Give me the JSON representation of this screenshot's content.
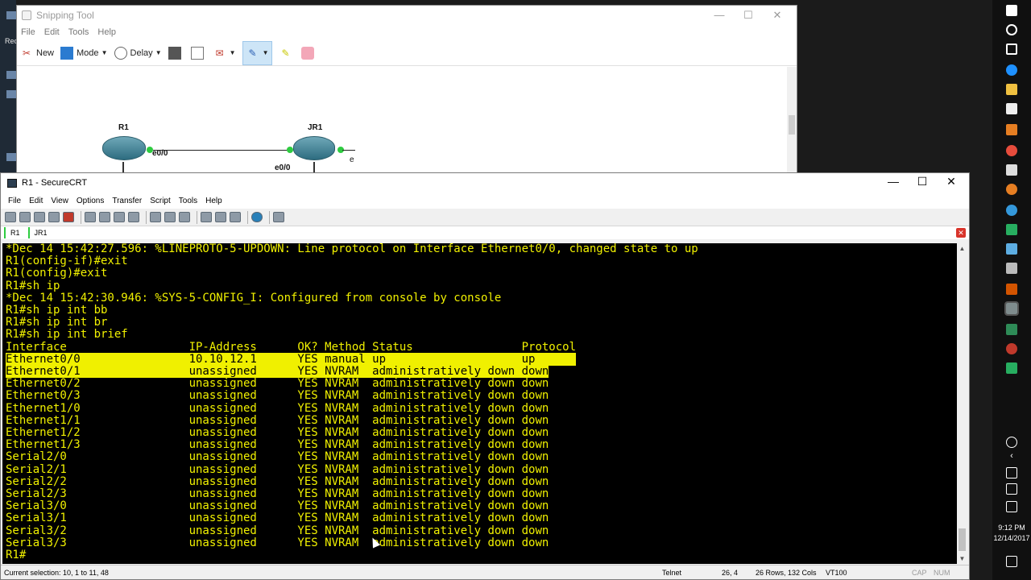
{
  "desktop": {
    "side_label": "Rec"
  },
  "snipping_tool": {
    "title": "Snipping Tool",
    "menu": [
      "File",
      "Edit",
      "Tools",
      "Help"
    ],
    "toolbar": {
      "new": "New",
      "mode": "Mode",
      "delay": "Delay"
    },
    "diagram": {
      "r1": "R1",
      "jr1": "JR1",
      "r1_port": "e0/0",
      "jr1_port": "e0/0",
      "jr1_port2": "e"
    }
  },
  "securecrt": {
    "title": "R1 - SecureCRT",
    "menu": [
      "File",
      "Edit",
      "View",
      "Options",
      "Transfer",
      "Script",
      "Tools",
      "Help"
    ],
    "tabs": [
      "R1",
      "JR1"
    ],
    "terminal_lines_top": [
      "*Dec 14 15:42:27.596: %LINEPROTO-5-UPDOWN: Line protocol on Interface Ethernet0/0, changed state to up",
      "R1(config-if)#exit",
      "R1(config)#exit",
      "R1#sh ip",
      "*Dec 14 15:42:30.946: %SYS-5-CONFIG_I: Configured from console by console",
      "R1#sh ip int bb",
      "R1#sh ip int br",
      "R1#sh ip int brief",
      "Interface                  IP-Address      OK? Method Status                Protocol"
    ],
    "highlighted_lines": [
      "Ethernet0/0                10.10.12.1      YES manual up                    up      ",
      "Ethernet0/1                unassigned      YES NVRAM  administratively down down"
    ],
    "terminal_lines_bottom": [
      "Ethernet0/2                unassigned      YES NVRAM  administratively down down",
      "Ethernet0/3                unassigned      YES NVRAM  administratively down down",
      "Ethernet1/0                unassigned      YES NVRAM  administratively down down",
      "Ethernet1/1                unassigned      YES NVRAM  administratively down down",
      "Ethernet1/2                unassigned      YES NVRAM  administratively down down",
      "Ethernet1/3                unassigned      YES NVRAM  administratively down down",
      "Serial2/0                  unassigned      YES NVRAM  administratively down down",
      "Serial2/1                  unassigned      YES NVRAM  administratively down down",
      "Serial2/2                  unassigned      YES NVRAM  administratively down down",
      "Serial2/3                  unassigned      YES NVRAM  administratively down down",
      "Serial3/0                  unassigned      YES NVRAM  administratively down down",
      "Serial3/1                  unassigned      YES NVRAM  administratively down down",
      "Serial3/2                  unassigned      YES NVRAM  administratively down down",
      "Serial3/3                  unassigned      YES NVRAM  administratively down down",
      "R1#"
    ],
    "status": {
      "selection": "Current selection: 10, 1 to 11, 48",
      "protocol": "Telnet",
      "position": "26,   4",
      "size": "26 Rows, 132 Cols",
      "emulation": "VT100",
      "cap": "CAP",
      "num": "NUM"
    }
  },
  "taskbar": {
    "time": "9:12 PM",
    "date": "12/14/2017"
  },
  "colors": {
    "terminal_text": "#f0f000",
    "terminal_bg": "#000000",
    "highlight": "#f0f000"
  }
}
